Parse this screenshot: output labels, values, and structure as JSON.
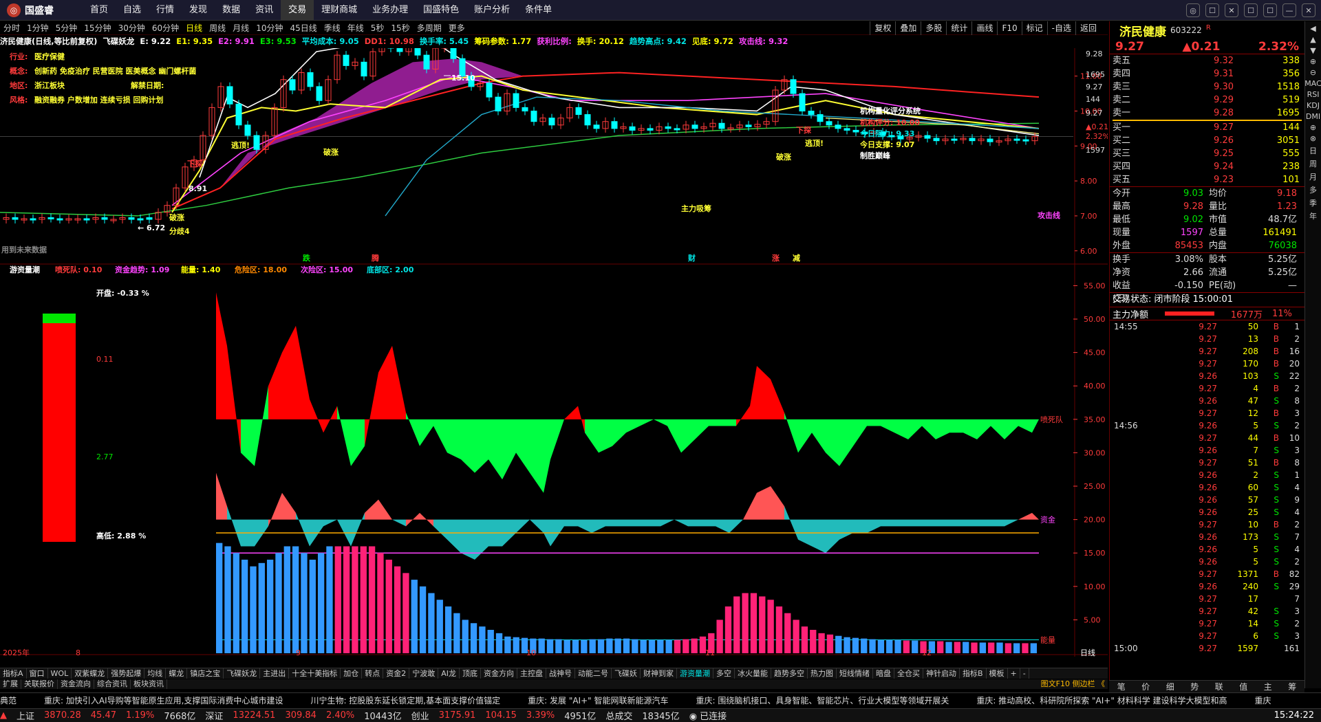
{
  "app": {
    "logo": "国盛睿",
    "menu": [
      "首页",
      "自选",
      "行情",
      "发现",
      "数据",
      "资讯",
      "交易",
      "理财商城",
      "业务办理",
      "国盛特色",
      "账户分析",
      "条件单"
    ],
    "active_menu": "交易",
    "win_buttons": [
      "◎",
      "☐",
      "✕",
      "☐",
      "☐",
      "—",
      "✕"
    ]
  },
  "periods": {
    "items": [
      "分时",
      "1分钟",
      "5分钟",
      "15分钟",
      "30分钟",
      "60分钟",
      "日线",
      "周线",
      "月线",
      "10分钟",
      "45日线",
      "季线",
      "年线",
      "5秒",
      "15秒",
      "多周期",
      "更多"
    ],
    "active": "日线",
    "tools": [
      "复权",
      "叠加",
      "多股",
      "统计",
      "画线",
      "F10",
      "标记",
      "-自选",
      "返回"
    ]
  },
  "infobar": [
    {
      "t": "济民健康(日线,等比前复权)",
      "c": "#ffffff"
    },
    {
      "t": "飞碟妖龙",
      "c": "#ffffff"
    },
    {
      "t": "E: 9.22",
      "c": "#ffffff"
    },
    {
      "t": "E1: 9.35",
      "c": "#ffff00"
    },
    {
      "t": "E2: 9.91",
      "c": "#ff44ff"
    },
    {
      "t": "E3: 9.53",
      "c": "#00e600"
    },
    {
      "t": "平均成本: 9.05",
      "c": "#00e6e6"
    },
    {
      "t": "DD1: 10.98",
      "c": "#ff3b3b"
    },
    {
      "t": "换手率: 5.45",
      "c": "#00e6e6"
    },
    {
      "t": "筹码参数: 1.77",
      "c": "#ffff00"
    },
    {
      "t": "获利比例:",
      "c": "#ff44ff"
    },
    {
      "t": "换手: 20.12",
      "c": "#ffff00"
    },
    {
      "t": "趋势高点: 9.42",
      "c": "#00e6e6"
    },
    {
      "t": "见底: 9.72",
      "c": "#ffff00"
    },
    {
      "t": "攻击线: 9.32",
      "c": "#ff44ff"
    }
  ],
  "stockinfo": [
    {
      "k": "行业:",
      "v": "医疗保健"
    },
    {
      "k": "概念:",
      "v": "创新药 免疫治疗 民营医院 医美概念 幽门螺杆菌"
    },
    {
      "k": "地区:",
      "v": "浙江板块",
      "x": "解禁日期:"
    },
    {
      "k": "风格:",
      "v": "融资融券 户数增加 连续亏损 回购计划"
    }
  ],
  "eval": {
    "title": "机构量化评分系统",
    "score": "机构评分: 10.00",
    "res": "今日阻力: 9.33",
    "sup": "今日支撑: 9.07",
    "tag": "制胜巅峰"
  },
  "annot": {
    "high": "15.10",
    "low": "6.72",
    "mid": "8.91",
    "zhuli": "主力吸筹",
    "gongji": "攻击线",
    "notfuture": "用到未来数据",
    "marks": [
      "跌",
      "腾",
      "财",
      "涨",
      "减"
    ],
    "sell": "下探",
    "sell2": "下探",
    "top": "逃顶!",
    "top2": "逃顶!",
    "jiezhang": "分歧4",
    "fz": "破涨",
    "fz2": "破涨",
    "fz3": "破涨"
  },
  "price_axis": [
    "11.00",
    "10.00",
    "9.00",
    "8.00",
    "7.00",
    "6.00"
  ],
  "side_axis": [
    "9.28",
    "1695",
    "9.27",
    "144",
    "9.27",
    "▲0.21",
    "2.32%",
    "1597"
  ],
  "sub": {
    "title": "游资量潮",
    "items": [
      {
        "t": "喷死队: 0.10",
        "c": "#ff3b3b"
      },
      {
        "t": "资金趋势: 1.09",
        "c": "#ff44ff"
      },
      {
        "t": "能量: 1.40",
        "c": "#ffff00"
      },
      {
        "t": "危险区: 18.00",
        "c": "#ff8800"
      },
      {
        "t": "次险区: 15.00",
        "c": "#ff44ff"
      },
      {
        "t": "底部区: 2.00",
        "c": "#00e6e6"
      }
    ],
    "open": "开盘:  -0.33 %",
    "v1": "0.11",
    "v2": "2.77",
    "high": "高低:  2.88 %",
    "labels": {
      "a": "喷死队",
      "b": "资金",
      "c": "能量"
    },
    "axis": [
      "55.00",
      "50.00",
      "45.00",
      "40.00",
      "35.00",
      "30.00",
      "25.00",
      "20.00",
      "15.00",
      "10.00",
      "5.00"
    ]
  },
  "dates": {
    "year": "2025年",
    "months": [
      "8",
      "9",
      "10",
      "11",
      "12"
    ],
    "end": "日线"
  },
  "side": {
    "name": "济民健康",
    "code": "603222",
    "flag": "R",
    "price": "9.27",
    "chg": "▲0.21",
    "pct": "2.32%",
    "asks": [
      {
        "l": "卖五",
        "p": "9.32",
        "v": "338"
      },
      {
        "l": "卖四",
        "p": "9.31",
        "v": "356"
      },
      {
        "l": "卖三",
        "p": "9.30",
        "v": "1518"
      },
      {
        "l": "卖二",
        "p": "9.29",
        "v": "519"
      },
      {
        "l": "卖一",
        "p": "9.28",
        "v": "1695"
      }
    ],
    "bids": [
      {
        "l": "买一",
        "p": "9.27",
        "v": "144"
      },
      {
        "l": "买二",
        "p": "9.26",
        "v": "3051"
      },
      {
        "l": "买三",
        "p": "9.25",
        "v": "555"
      },
      {
        "l": "买四",
        "p": "9.24",
        "v": "238"
      },
      {
        "l": "买五",
        "p": "9.23",
        "v": "101"
      }
    ],
    "stats": [
      [
        {
          "t": "今开",
          "c": "#ddd"
        },
        {
          "t": "9.03",
          "c": "#00e600"
        },
        {
          "t": "均价",
          "c": "#ddd"
        },
        {
          "t": "9.18",
          "c": "#ff3b3b"
        }
      ],
      [
        {
          "t": "最高",
          "c": "#ddd"
        },
        {
          "t": "9.28",
          "c": "#ff3b3b"
        },
        {
          "t": "量比",
          "c": "#ddd"
        },
        {
          "t": "1.23",
          "c": "#ff3b3b"
        }
      ],
      [
        {
          "t": "最低",
          "c": "#ddd"
        },
        {
          "t": "9.02",
          "c": "#00e600"
        },
        {
          "t": "市值",
          "c": "#ddd"
        },
        {
          "t": "48.7亿",
          "c": "#ddd"
        }
      ],
      [
        {
          "t": "现量",
          "c": "#ddd"
        },
        {
          "t": "1597",
          "c": "#ff44ff"
        },
        {
          "t": "总量",
          "c": "#ddd"
        },
        {
          "t": "161491",
          "c": "#ffff00"
        }
      ],
      [
        {
          "t": "外盘",
          "c": "#ddd"
        },
        {
          "t": "85453",
          "c": "#ff3b3b"
        },
        {
          "t": "内盘",
          "c": "#ddd"
        },
        {
          "t": "76038",
          "c": "#00e600"
        }
      ]
    ],
    "stats2": [
      [
        {
          "t": "换手",
          "c": "#ddd"
        },
        {
          "t": "3.08%",
          "c": "#ddd"
        },
        {
          "t": "股本",
          "c": "#ddd"
        },
        {
          "t": "5.25亿",
          "c": "#ddd"
        }
      ],
      [
        {
          "t": "净资",
          "c": "#ddd"
        },
        {
          "t": "2.66",
          "c": "#ddd"
        },
        {
          "t": "流通",
          "c": "#ddd"
        },
        {
          "t": "5.25亿",
          "c": "#ddd"
        }
      ],
      [
        {
          "t": "收益(三)",
          "c": "#ddd"
        },
        {
          "t": "-0.150",
          "c": "#ddd"
        },
        {
          "t": "PE(动)",
          "c": "#ddd"
        },
        {
          "t": "—",
          "c": "#ddd"
        }
      ]
    ],
    "trade_state": "交易状态: 闭市阶段 15:00:01",
    "netflow": {
      "l": "主力净额",
      "v": "1677万",
      "p": "11%",
      "fill": 0.8
    },
    "ticks": [
      {
        "t": "14:55",
        "p": "9.27",
        "v": "50",
        "s": "B",
        "n": "1"
      },
      {
        "t": "",
        "p": "9.27",
        "v": "13",
        "s": "B",
        "n": "2"
      },
      {
        "t": "",
        "p": "9.27",
        "v": "208",
        "s": "B",
        "n": "16"
      },
      {
        "t": "",
        "p": "9.27",
        "v": "170",
        "s": "B",
        "n": "20"
      },
      {
        "t": "",
        "p": "9.26",
        "v": "103",
        "s": "S",
        "n": "22"
      },
      {
        "t": "",
        "p": "9.27",
        "v": "4",
        "s": "B",
        "n": "2"
      },
      {
        "t": "",
        "p": "9.26",
        "v": "47",
        "s": "S",
        "n": "8"
      },
      {
        "t": "",
        "p": "9.27",
        "v": "12",
        "s": "B",
        "n": "3"
      },
      {
        "t": "14:56",
        "p": "9.26",
        "v": "5",
        "s": "S",
        "n": "2"
      },
      {
        "t": "",
        "p": "9.27",
        "v": "44",
        "s": "B",
        "n": "10"
      },
      {
        "t": "",
        "p": "9.26",
        "v": "7",
        "s": "S",
        "n": "3"
      },
      {
        "t": "",
        "p": "9.27",
        "v": "51",
        "s": "B",
        "n": "8"
      },
      {
        "t": "",
        "p": "9.26",
        "v": "2",
        "s": "S",
        "n": "1"
      },
      {
        "t": "",
        "p": "9.26",
        "v": "60",
        "s": "S",
        "n": "4"
      },
      {
        "t": "",
        "p": "9.26",
        "v": "57",
        "s": "S",
        "n": "9"
      },
      {
        "t": "",
        "p": "9.26",
        "v": "25",
        "s": "S",
        "n": "4"
      },
      {
        "t": "",
        "p": "9.27",
        "v": "10",
        "s": "B",
        "n": "2"
      },
      {
        "t": "",
        "p": "9.26",
        "v": "173",
        "s": "S",
        "n": "7"
      },
      {
        "t": "",
        "p": "9.26",
        "v": "5",
        "s": "S",
        "n": "4"
      },
      {
        "t": "",
        "p": "9.26",
        "v": "5",
        "s": "S",
        "n": "2"
      },
      {
        "t": "",
        "p": "9.27",
        "v": "1371",
        "s": "B",
        "n": "82"
      },
      {
        "t": "",
        "p": "9.26",
        "v": "240",
        "s": "S",
        "n": "29"
      },
      {
        "t": "",
        "p": "9.27",
        "v": "17",
        "s": "",
        "n": "7"
      },
      {
        "t": "",
        "p": "9.27",
        "v": "42",
        "s": "S",
        "n": "3"
      },
      {
        "t": "",
        "p": "9.27",
        "v": "14",
        "s": "S",
        "n": "2"
      },
      {
        "t": "",
        "p": "9.27",
        "v": "6",
        "s": "S",
        "n": "3"
      },
      {
        "t": "15:00",
        "p": "9.27",
        "v": "1597",
        "s": "",
        "n": "161"
      }
    ],
    "tabs": [
      "笔",
      "价",
      "细",
      "势",
      "联",
      "值",
      "主",
      "筹"
    ]
  },
  "scrollcol": [
    "◀",
    "▲",
    "▼",
    "⊕",
    "⊖",
    "MAC",
    "RSI",
    "KDJ",
    "DMI",
    "⊕",
    "⊗",
    "日",
    "周",
    "月",
    "多",
    "季",
    "年"
  ],
  "bottomtabs": [
    "指标A",
    "窗口",
    "WOL",
    "双紫蝶龙",
    "强势起爆",
    "均线",
    "蝶龙",
    "镇店之宝",
    "飞碟妖龙",
    "主进出",
    "十全十美指标",
    "加仓",
    "转点",
    "资金2",
    "宁波敢",
    "AI龙",
    "顶底",
    "资金方向",
    "主控盘",
    "战神号",
    "动能二号",
    "飞碟妖",
    "财神到家",
    "游资量潮",
    "多空",
    "冰火量能",
    "趋势多空",
    "热力图",
    "短线情绪",
    "暗盘",
    "全仓买",
    "神针启动",
    "指标B",
    "模板",
    "+",
    "-"
  ],
  "active_tab": "游资量潮",
  "tabs2": [
    "扩展",
    "关联报价",
    "资金流向",
    "综合资讯",
    "板块资讯"
  ],
  "tabs2_right": "图文F10 侧边栏 《",
  "news": [
    "典范",
    "重庆: 加快引入AI导购等智能原生应用,支撑国际消费中心城市建设",
    "川宁生物: 控股股东延长锁定期,基本面支撑价值锚定",
    "重庆: 发展 \"AI+\" 智能网联新能源汽车",
    "重庆: 围绕脑机接口、具身智能、智能芯片、行业大模型等领域开展关",
    "重庆: 推动高校、科研院所探索 \"AI+\" 材料科学 建设科学大模型和高",
    "重庆"
  ],
  "status": [
    {
      "t": "上证",
      "c": "#ddd"
    },
    {
      "t": "3870.28",
      "c": "#ff3b3b"
    },
    {
      "t": "45.47",
      "c": "#ff3b3b"
    },
    {
      "t": "1.19%",
      "c": "#ff3b3b"
    },
    {
      "t": "7668亿",
      "c": "#ddd"
    },
    {
      "t": "深证",
      "c": "#ddd"
    },
    {
      "t": "13224.51",
      "c": "#ff3b3b"
    },
    {
      "t": "309.84",
      "c": "#ff3b3b"
    },
    {
      "t": "2.40%",
      "c": "#ff3b3b"
    },
    {
      "t": "10443亿",
      "c": "#ddd"
    },
    {
      "t": "创业",
      "c": "#ddd"
    },
    {
      "t": "3175.91",
      "c": "#ff3b3b"
    },
    {
      "t": "104.15",
      "c": "#ff3b3b"
    },
    {
      "t": "3.39%",
      "c": "#ff3b3b"
    },
    {
      "t": "4951亿",
      "c": "#ddd"
    },
    {
      "t": "总成交",
      "c": "#ddd"
    },
    {
      "t": "18345亿",
      "c": "#ddd"
    },
    {
      "t": "◉ 已连接",
      "c": "#ddd"
    }
  ],
  "clock": "15:24:22"
}
